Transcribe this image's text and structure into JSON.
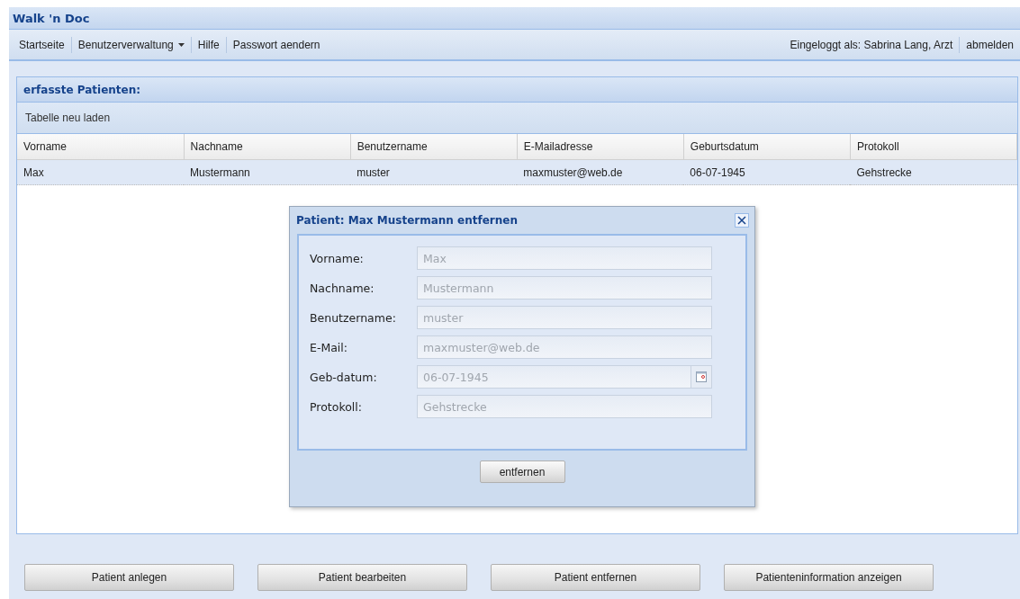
{
  "app_title": "Walk 'n Doc",
  "menu": [
    {
      "label": "Startseite",
      "dropdown": false
    },
    {
      "label": "Benutzerverwaltung",
      "dropdown": true
    },
    {
      "label": "Hilfe",
      "dropdown": false
    },
    {
      "label": "Passwort aendern",
      "dropdown": false
    }
  ],
  "user_info": "Eingeloggt als: Sabrina Lang, Arzt",
  "logout": "abmelden",
  "panel": {
    "title": "erfasste Patienten:",
    "toolbar": [
      "Tabelle neu laden"
    ],
    "table": {
      "columns": [
        "Vorname",
        "Nachname",
        "Benutzername",
        "E-Mailadresse",
        "Geburtsdatum",
        "Protokoll"
      ],
      "rows": [
        {
          "cells": [
            "Max",
            "Mustermann",
            "muster",
            "maxmuster@web.de",
            "06-07-1945",
            "Gehstrecke"
          ],
          "selected": true
        }
      ]
    }
  },
  "buttons": [
    "Patient anlegen",
    "Patient bearbeiten",
    "Patient entfernen",
    "Patienteninformation anzeigen"
  ],
  "dialog": {
    "title": "Patient: Max Mustermann entfernen",
    "fields": [
      {
        "label": "Vorname:",
        "value": "Max",
        "disabled": true,
        "kind": "text"
      },
      {
        "label": "Nachname:",
        "value": "Mustermann",
        "disabled": true,
        "kind": "text"
      },
      {
        "label": "Benutzername:",
        "value": "muster",
        "disabled": true,
        "kind": "text"
      },
      {
        "label": "E-Mail:",
        "value": "maxmuster@web.de",
        "disabled": true,
        "kind": "text"
      },
      {
        "label": "Geb-datum:",
        "value": "06-07-1945",
        "disabled": true,
        "kind": "date"
      },
      {
        "label": "Protokoll:",
        "value": "Gehstrecke",
        "disabled": true,
        "kind": "text"
      }
    ],
    "button": "entfernen"
  }
}
